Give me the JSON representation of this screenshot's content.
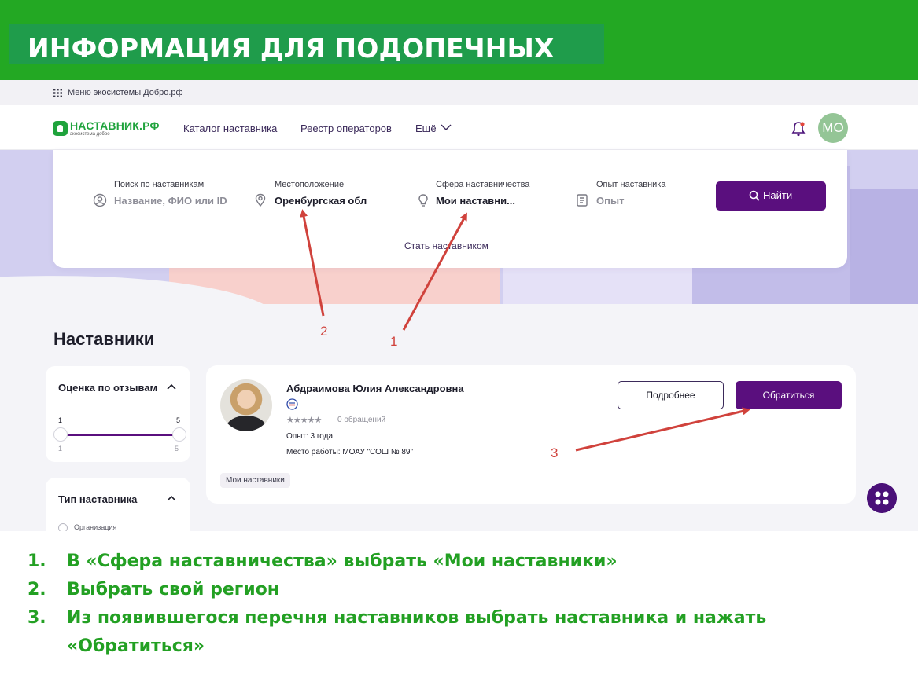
{
  "slide": {
    "title": "ИНФОРМАЦИЯ ДЛЯ ПОДОПЕЧНЫХ"
  },
  "ecosystem_bar": {
    "label": "Меню экосистемы Добро.рф"
  },
  "navbar": {
    "logo_name": "НАСТАВНИК.РФ",
    "logo_sub": "экосистема добро",
    "links": [
      "Каталог наставника",
      "Реестр операторов",
      "Ещё"
    ],
    "avatar_initials": "МО"
  },
  "search": {
    "fields": [
      {
        "label": "Поиск по наставникам",
        "value": "Название, ФИО или ID",
        "icon": "user-circle-icon"
      },
      {
        "label": "Местоположение",
        "value": "Оренбургская обл",
        "icon": "location-pin-icon"
      },
      {
        "label": "Сфера наставничества",
        "value": "Мои наставни...",
        "icon": "lightbulb-icon"
      },
      {
        "label": "Опыт наставника",
        "value": "Опыт",
        "icon": "document-icon"
      }
    ],
    "find_button": "Найти",
    "become_link": "Стать наставником"
  },
  "section_title": "Наставники",
  "filters": {
    "rating": {
      "title": "Оценка по отзывам",
      "min_label": "1",
      "max_label": "5",
      "range": [
        1,
        5
      ]
    },
    "type": {
      "title": "Тип наставника",
      "option": "Организация"
    }
  },
  "mentor": {
    "name": "Абдраимова Юлия Александровна",
    "stars": "★★★★★",
    "requests": "0 обращений",
    "experience": "Опыт: 3 года",
    "workplace": "Место работы: МОАУ \"СОШ № 89\"",
    "tag": "Мои наставники",
    "details_button": "Подробнее",
    "contact_button": "Обратиться"
  },
  "annotations": {
    "markers": [
      "1",
      "2",
      "3"
    ],
    "color": "#d0423c"
  },
  "instructions": {
    "steps": [
      {
        "num": "1.",
        "text": "В «Сфера наставничества» выбрать «Мои наставники»"
      },
      {
        "num": "2.",
        "text": "Выбрать свой регион"
      },
      {
        "num": "3.",
        "text": "Из появившегося перечня наставников выбрать наставника и нажать"
      }
    ],
    "step3_continued": "«Обратиться»"
  },
  "colors": {
    "accent_green": "#23a823",
    "brand_purple": "#5a0f7e",
    "instruction_green": "#23a023"
  }
}
